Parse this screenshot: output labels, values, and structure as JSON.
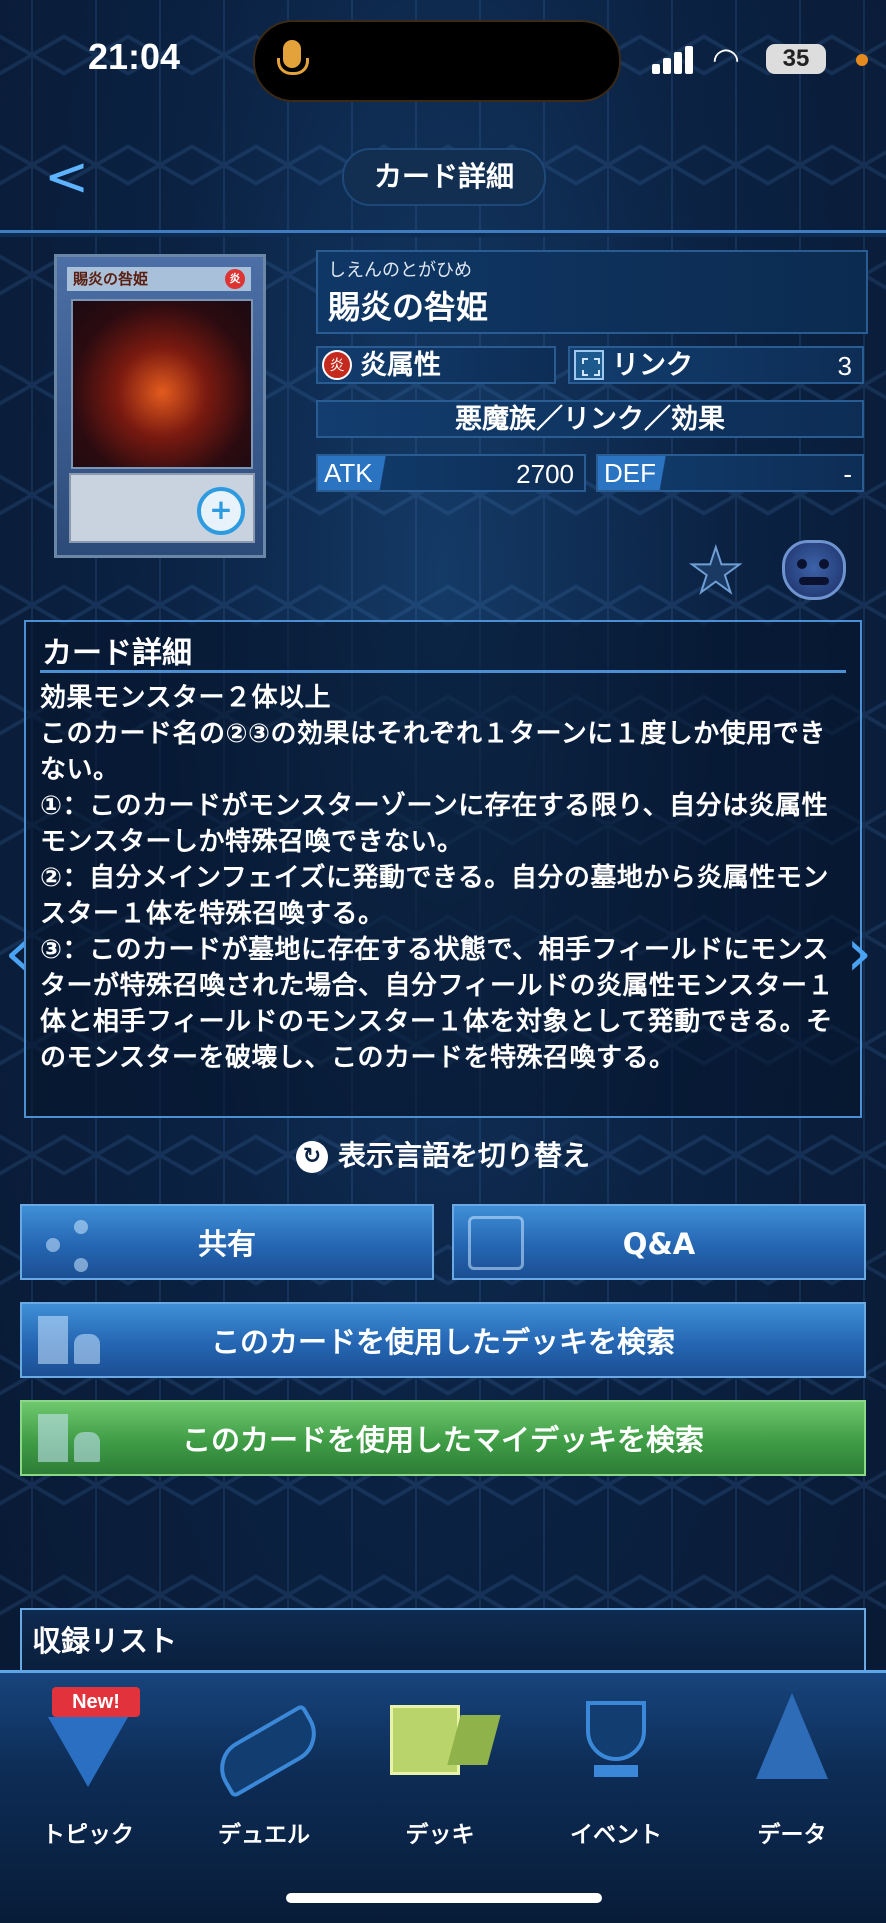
{
  "status": {
    "time": "21:04",
    "battery": "35"
  },
  "header": {
    "title": "カード詳細",
    "back_icon": "chevron-left-icon"
  },
  "card": {
    "image_name": "賜炎の咎姫",
    "image_attr": "炎",
    "ruby": "しえんのとがひめ",
    "name": "賜炎の咎姫",
    "attribute": "炎属性",
    "attribute_glyph": "炎",
    "link_label": "リンク",
    "link_value": "3",
    "type": "悪魔族／リンク／効果",
    "atk_label": "ATK",
    "atk": "2700",
    "def_label": "DEF",
    "def": "-"
  },
  "description": {
    "title": "カード詳細",
    "text": "効果モンスター２体以上\nこのカード名の②③の効果はそれぞれ１ターンに１度しか使用できない。\n①：このカードがモンスターゾーンに存在する限り、自分は炎属性モンスターしか特殊召喚できない。\n②：自分メインフェイズに発動できる。自分の墓地から炎属性モンスター１体を特殊召喚する。\n③：このカードが墓地に存在する状態で、相手フィールドにモンスターが特殊召喚された場合、自分フィールドの炎属性モンスター１体と相手フィールドのモンスター１体を対象として発動できる。そのモンスターを破壊し、このカードを特殊召喚する。"
  },
  "lang_toggle": "表示言語を切り替え",
  "buttons": {
    "share": "共有",
    "qa": "Q&A",
    "search_deck": "このカードを使用したデッキを検索",
    "search_my_deck": "このカードを使用したマイデッキを検索"
  },
  "record_list": "収録リスト",
  "nav": {
    "new_badge": "New!",
    "items": [
      "トピック",
      "デュエル",
      "デッキ",
      "イベント",
      "データ"
    ]
  },
  "colors": {
    "accent": "#4d8fd3",
    "button_blue": "#2566b3",
    "button_green": "#3f9d46",
    "new_badge": "#e2323b"
  }
}
